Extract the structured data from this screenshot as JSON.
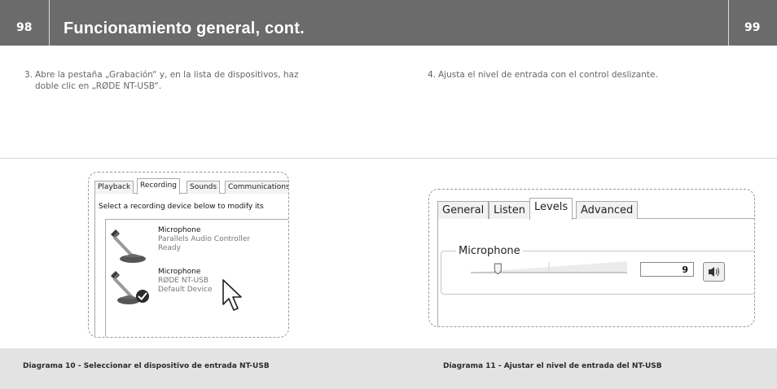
{
  "header": {
    "page_left": "98",
    "page_right": "99",
    "title": "Funcionamiento general, cont."
  },
  "steps": {
    "step3": {
      "number": "3.",
      "line1": "Abre la pestaña „Grabación“ y, en la lista de dispositivos, haz",
      "line2": "doble clic en „RØDE NT-USB“."
    },
    "step4": {
      "number": "4.",
      "text": "Ajusta el nivel de entrada con el control deslizante."
    }
  },
  "figure10": {
    "tabs": [
      "Playback",
      "Recording",
      "Sounds",
      "Communications"
    ],
    "active_tab": "Recording",
    "instruction": "Select a recording device below to modify its",
    "devices": [
      {
        "name": "Microphone",
        "detail": "Parallels Audio Controller",
        "status": "Ready",
        "default": false
      },
      {
        "name": "Microphone",
        "detail": "RØDE NT-USB",
        "status": "Default Device",
        "default": true
      }
    ],
    "caption": "Diagrama 10 - Seleccionar el dispositivo de entrada NT-USB"
  },
  "figure11": {
    "tabs": [
      "General",
      "Listen",
      "Levels",
      "Advanced"
    ],
    "active_tab": "Levels",
    "group_label": "Microphone",
    "level_value": "9",
    "level_fraction": 0.09,
    "caption": "Diagrama 11 - Ajustar el nivel de entrada del NT-USB"
  },
  "icons": {
    "microphone": "microphone-icon",
    "default_check": "checkmark-icon",
    "cursor": "mouse-pointer-icon",
    "speaker": "speaker-icon"
  },
  "colors": {
    "header_bg": "#6b6b6b",
    "caption_bg": "#e3e3e3"
  }
}
